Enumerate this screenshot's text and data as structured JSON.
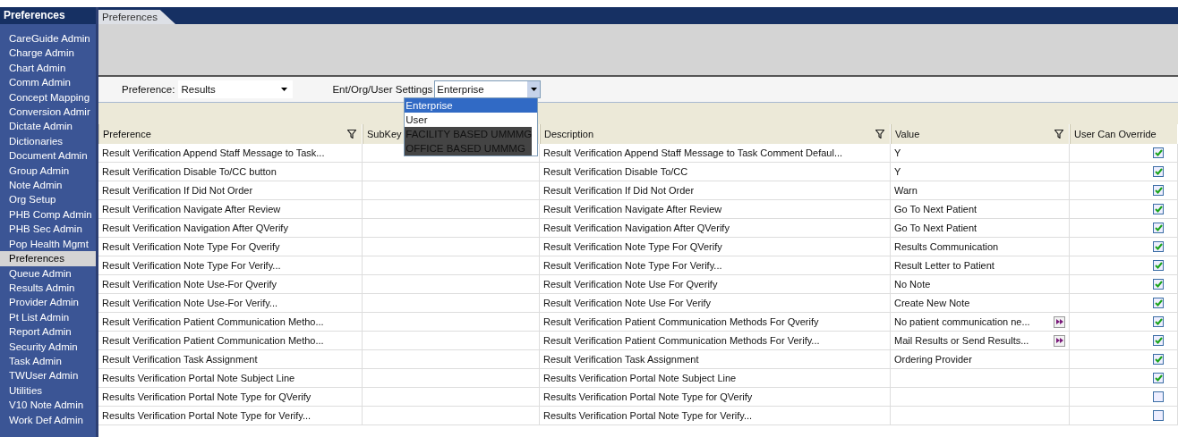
{
  "sidebar": {
    "title": "Preferences",
    "items": [
      {
        "label": "CareGuide Admin",
        "selected": false
      },
      {
        "label": "Charge Admin",
        "selected": false
      },
      {
        "label": "Chart Admin",
        "selected": false
      },
      {
        "label": "Comm Admin",
        "selected": false
      },
      {
        "label": "Concept Mapping",
        "selected": false
      },
      {
        "label": "Conversion Admir",
        "selected": false
      },
      {
        "label": "Dictate Admin",
        "selected": false
      },
      {
        "label": "Dictionaries",
        "selected": false
      },
      {
        "label": "Document Admin",
        "selected": false
      },
      {
        "label": "Group Admin",
        "selected": false
      },
      {
        "label": "Note Admin",
        "selected": false
      },
      {
        "label": "Org Setup",
        "selected": false
      },
      {
        "label": "PHB Comp Admin",
        "selected": false
      },
      {
        "label": "PHB Sec Admin",
        "selected": false
      },
      {
        "label": "Pop Health Mgmt",
        "selected": false
      },
      {
        "label": "Preferences",
        "selected": true
      },
      {
        "label": "Queue Admin",
        "selected": false
      },
      {
        "label": "Results Admin",
        "selected": false
      },
      {
        "label": "Provider Admin",
        "selected": false
      },
      {
        "label": "Pt List Admin",
        "selected": false
      },
      {
        "label": "Report Admin",
        "selected": false
      },
      {
        "label": "Security Admin",
        "selected": false
      },
      {
        "label": "Task Admin",
        "selected": false
      },
      {
        "label": "TWUser Admin",
        "selected": false
      },
      {
        "label": "Utilities",
        "selected": false
      },
      {
        "label": "V10 Note Admin",
        "selected": false
      },
      {
        "label": "Work Def Admin",
        "selected": false
      }
    ]
  },
  "tabs": [
    {
      "label": "Preferences",
      "selected": true
    }
  ],
  "toolbar": {
    "preference_label": "Preference:",
    "preference_value": "Results",
    "settings_label": "Ent/Org/User Settings",
    "settings_value": "Enterprise",
    "settings_options": [
      {
        "label": "Enterprise",
        "selected": true,
        "disabled": false
      },
      {
        "label": "User",
        "selected": false,
        "disabled": false
      },
      {
        "label": "FACILITY BASED UMMMG",
        "selected": false,
        "disabled": true
      },
      {
        "label": "OFFICE BASED UMMMG",
        "selected": false,
        "disabled": true
      }
    ]
  },
  "table": {
    "columns": [
      {
        "label": "Preference",
        "filter": true
      },
      {
        "label": "SubKey"
      },
      {
        "label": "Description",
        "filter": true
      },
      {
        "label": "Value",
        "filter": true
      },
      {
        "label": "User Can Override",
        "filter": false
      }
    ],
    "rows": [
      {
        "preference": "Result Verification Append Staff Message to Task...",
        "description": "Result Verification Append Staff Message to Task Comment Defaul...",
        "value": "Y",
        "more": false,
        "override": true
      },
      {
        "preference": "Result Verification Disable To/CC button",
        "description": "Result Verification Disable To/CC",
        "value": "Y",
        "more": false,
        "override": true
      },
      {
        "preference": "Result Verification If Did Not Order",
        "description": "Result Verification If Did Not Order",
        "value": "Warn",
        "more": false,
        "override": true
      },
      {
        "preference": "Result Verification Navigate After Review",
        "description": "Result Verification Navigate After Review",
        "value": "Go To Next Patient",
        "more": false,
        "override": true
      },
      {
        "preference": "Result Verification Navigation After QVerify",
        "description": "Result Verification Navigation After QVerify",
        "value": "Go To Next Patient",
        "more": false,
        "override": true
      },
      {
        "preference": "Result Verification Note Type For Qverify",
        "description": "Result Verification Note Type For QVerify",
        "value": "Results Communication",
        "more": false,
        "override": true
      },
      {
        "preference": "Result Verification Note Type For Verify...",
        "description": "Result Verification Note Type For Verify...",
        "value": "Result Letter to Patient",
        "more": false,
        "override": true
      },
      {
        "preference": "Result Verification Note Use-For Qverify",
        "description": "Result Verification Note Use For Qverify",
        "value": "No Note",
        "more": false,
        "override": true
      },
      {
        "preference": "Result Verification Note Use-For Verify...",
        "description": "Result Verification Note Use For Verify",
        "value": "Create New Note",
        "more": false,
        "override": true
      },
      {
        "preference": "Result Verification Patient Communication Metho...",
        "description": "Result Verification Patient Communication Methods For Qverify",
        "value": "No patient communication ne...",
        "more": true,
        "override": true
      },
      {
        "preference": "Result Verification Patient Communication Metho...",
        "description": "Result Verification Patient Communication Methods For Verify...",
        "value": "Mail Results or Send Results...",
        "more": true,
        "override": true
      },
      {
        "preference": "Result Verification Task Assignment",
        "description": "Result Verification Task Assignment",
        "value": "Ordering Provider",
        "more": false,
        "override": true
      },
      {
        "preference": "Results Verification Portal Note Subject Line",
        "description": "Results Verification Portal Note Subject Line",
        "more": false,
        "override": true
      },
      {
        "preference": "Results Verification Portal Note Type for QVerify",
        "description": "Results Verification Portal Note Type for QVerify",
        "more": false,
        "override": false
      },
      {
        "preference": "Results Verification Portal Note Type for Verify...",
        "description": "Results Verification Portal Note Type for Verify...",
        "more": false,
        "override": false
      }
    ]
  }
}
